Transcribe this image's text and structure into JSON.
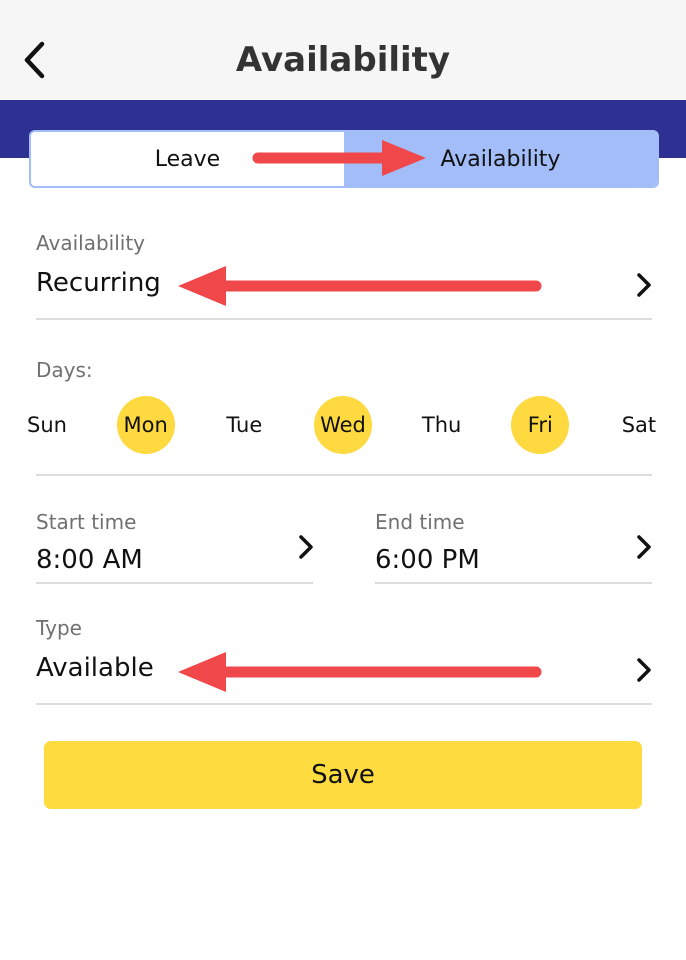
{
  "header": {
    "title": "Availability",
    "back_icon": "chevron-left-icon"
  },
  "segment": {
    "tabs": [
      {
        "label": "Leave",
        "active": false
      },
      {
        "label": "Availability",
        "active": true
      }
    ]
  },
  "availability": {
    "label": "Availability",
    "value": "Recurring"
  },
  "days": {
    "label": "Days:",
    "items": [
      {
        "label": "Sun",
        "selected": false
      },
      {
        "label": "Mon",
        "selected": true
      },
      {
        "label": "Tue",
        "selected": false
      },
      {
        "label": "Wed",
        "selected": true
      },
      {
        "label": "Thu",
        "selected": false
      },
      {
        "label": "Fri",
        "selected": true
      },
      {
        "label": "Sat",
        "selected": false
      }
    ]
  },
  "start_time": {
    "label": "Start time",
    "value": "8:00 AM"
  },
  "end_time": {
    "label": "End time",
    "value": "6:00 PM"
  },
  "type": {
    "label": "Type",
    "value": "Available"
  },
  "save_label": "Save",
  "colors": {
    "header_bg": "#f6f6f6",
    "band": "#2e3192",
    "segment_active": "#a3bdf8",
    "day_selected": "#fed93f",
    "save_button": "#fedb3f",
    "annotation_arrow": "#f0474a"
  }
}
